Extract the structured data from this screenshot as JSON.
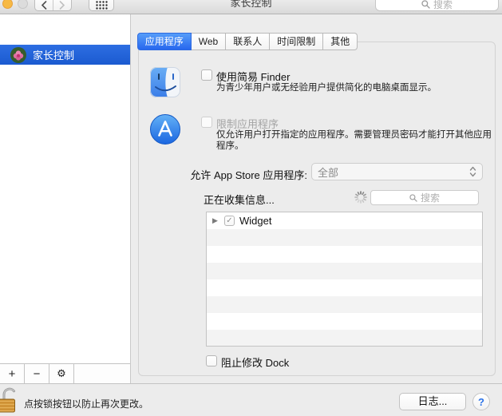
{
  "toolbar": {
    "title": "家长控制",
    "search_placeholder": "搜索"
  },
  "sidebar": {
    "user": {
      "name": "家长控制",
      "selected": true
    },
    "footer": {
      "add": "+",
      "remove": "−",
      "gear": "⚙"
    }
  },
  "tabs": {
    "items": [
      {
        "label": "应用程序",
        "selected": true
      },
      {
        "label": "Web",
        "selected": false
      },
      {
        "label": "联系人",
        "selected": false
      },
      {
        "label": "时间限制",
        "selected": false
      },
      {
        "label": "其他",
        "selected": false
      }
    ]
  },
  "content": {
    "simple_finder_label": "使用简易 Finder",
    "simple_finder_desc": "为青少年用户或无经验用户提供简化的电脑桌面显示。",
    "simple_finder_checked": false,
    "limit_apps_label": "限制应用程序",
    "limit_apps_desc": "仅允许用户打开指定的应用程序。需要管理员密码才能打开其他应用程序。",
    "limit_apps_checked": false,
    "allow_store_label": "允许 App Store 应用程序:",
    "allow_store_value": "全部",
    "collecting_label": "正在收集信息...",
    "list_search_placeholder": "搜索",
    "app_list": [
      {
        "label": "Widget",
        "checked": true,
        "expandable": true
      }
    ],
    "dock_label": "阻止修改 Dock",
    "dock_checked": false
  },
  "footer": {
    "lock_hint": "点按锁按钮以防止再次更改。",
    "logs_button": "日志...",
    "help_button": "?"
  },
  "icons": {
    "check": "✓",
    "disclosure": "▶",
    "gear": "⚙",
    "plus": "+",
    "minus": "−"
  },
  "colors": {
    "selection_blue": "#2066dc",
    "tab_selected_blue": "#2f77f1",
    "traffic_orange": "#f7b944",
    "help_blue": "#2a72e8"
  }
}
